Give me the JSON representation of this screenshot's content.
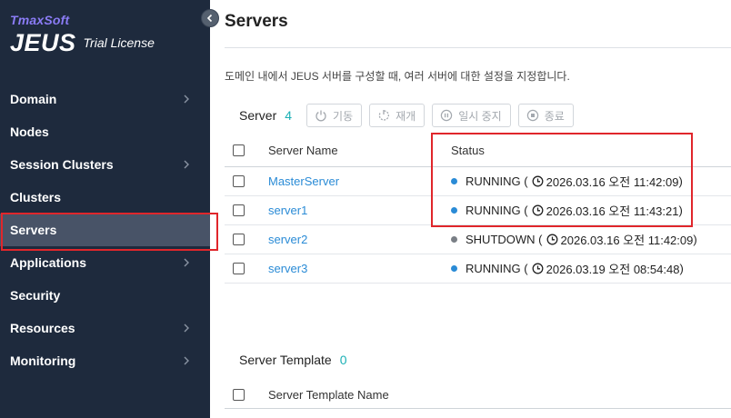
{
  "sidebar": {
    "brand_company": "TmaxSoft",
    "brand_product": "JEUS",
    "brand_license": "Trial License",
    "items": [
      {
        "label": "Domain"
      },
      {
        "label": "Nodes"
      },
      {
        "label": "Session Clusters"
      },
      {
        "label": "Clusters"
      },
      {
        "label": "Servers"
      },
      {
        "label": "Applications"
      },
      {
        "label": "Security"
      },
      {
        "label": "Resources"
      },
      {
        "label": "Monitoring"
      }
    ]
  },
  "page": {
    "title": "Servers",
    "description": "도메인 내에서 JEUS 서버를 구성할 때, 여러 서버에 대한 설정을 지정합니다."
  },
  "servers": {
    "section_title": "Server",
    "count": "4",
    "buttons": {
      "start": "기동",
      "restart": "재개",
      "suspend": "일시 중지",
      "stop": "종료"
    },
    "columns": {
      "name": "Server Name",
      "status": "Status"
    },
    "rows": [
      {
        "name": "MasterServer",
        "state": "RUNNING",
        "time": "2026.03.16 오전 11:42:09"
      },
      {
        "name": "server1",
        "state": "RUNNING",
        "time": "2026.03.16 오전 11:43:21"
      },
      {
        "name": "server2",
        "state": "SHUTDOWN",
        "time": "2026.03.16 오전 11:42:09"
      },
      {
        "name": "server3",
        "state": "RUNNING",
        "time": "2026.03.19 오전 08:54:48"
      }
    ]
  },
  "templates": {
    "section_title": "Server Template",
    "count": "0",
    "columns": {
      "name": "Server Template Name"
    }
  },
  "colors": {
    "sidebar_bg": "#1e2a3d",
    "running": "#2a8bd6",
    "shutdown": "#7a7f86",
    "highlight": "#e0262b",
    "count": "#1bb0b5"
  }
}
